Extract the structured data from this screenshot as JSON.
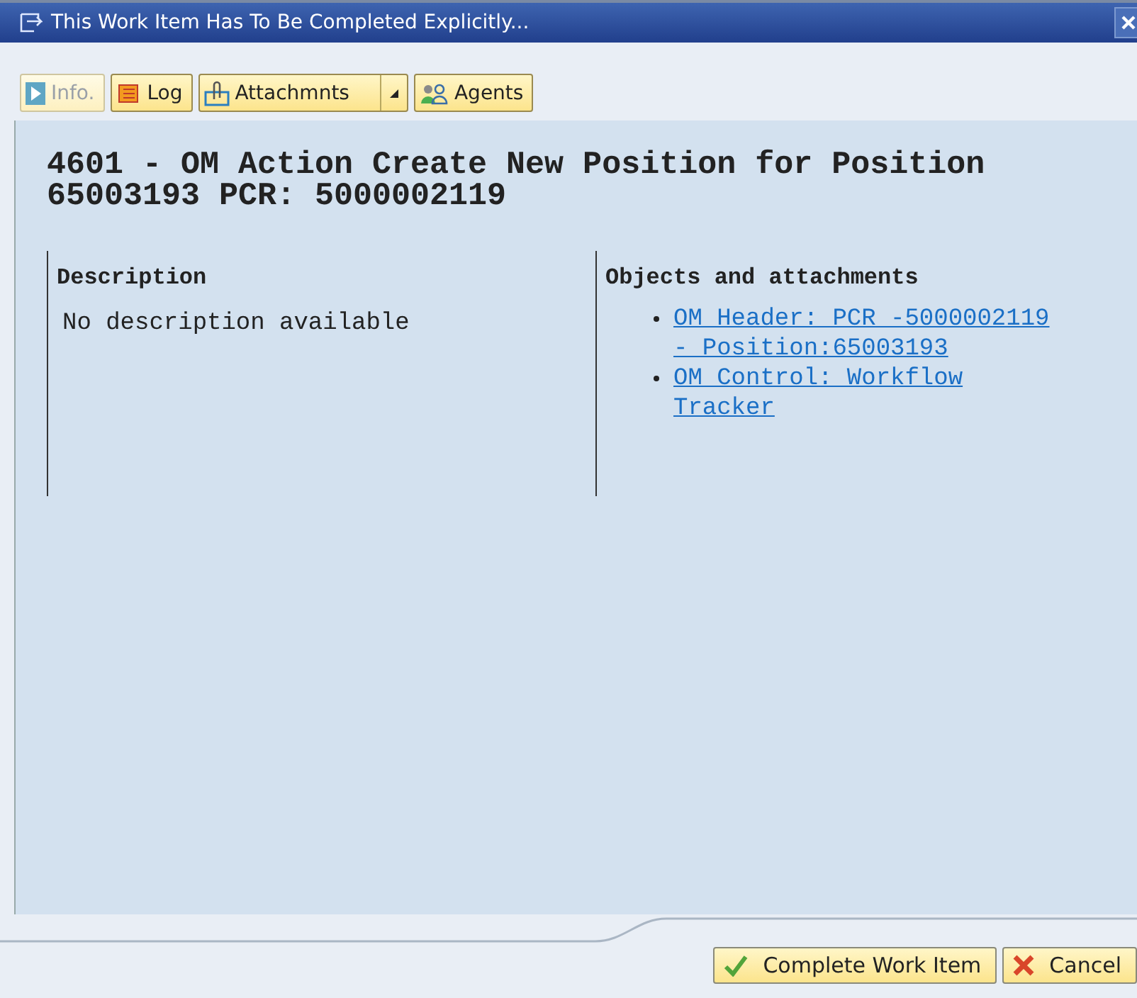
{
  "window": {
    "title": "This Work Item Has To Be Completed Explicitly..."
  },
  "toolbar": [
    {
      "kind": "info",
      "label": "Info.",
      "disabled": true,
      "dropdown": false
    },
    {
      "kind": "log",
      "label": "Log",
      "disabled": false,
      "dropdown": false
    },
    {
      "kind": "attachments",
      "label": "Attachmnts",
      "disabled": false,
      "dropdown": true
    },
    {
      "kind": "agents",
      "label": "Agents",
      "disabled": false,
      "dropdown": false
    }
  ],
  "heading": "4601 - OM Action Create New Position for Position 65003193 PCR: 5000002119",
  "description": {
    "title": "Description",
    "text": "No description available"
  },
  "objects": {
    "title": "Objects and attachments",
    "links": [
      "OM Header: PCR -5000002119 - Position:65003193",
      "OM Control: Workflow Tracker"
    ]
  },
  "buttons": [
    {
      "kind": "ok",
      "label": "Complete Work Item"
    },
    {
      "kind": "cancel",
      "label": "Cancel"
    }
  ]
}
